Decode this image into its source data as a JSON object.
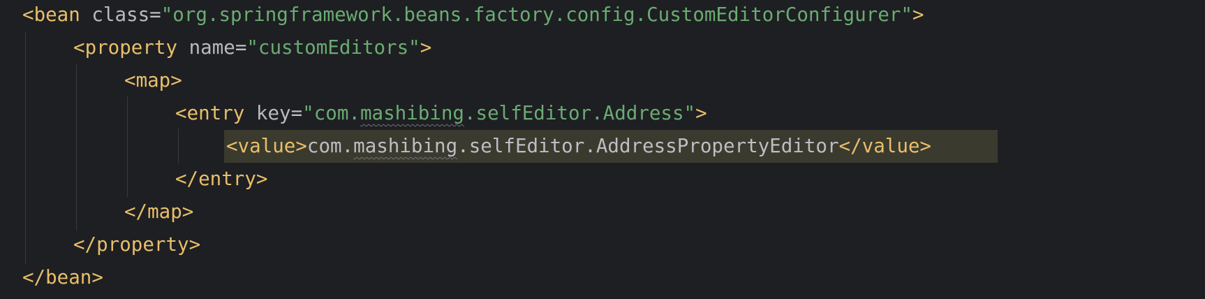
{
  "editor": {
    "lines": {
      "l1": {
        "open": "<",
        "tag": "bean",
        "attr": "class",
        "eq": "=",
        "value": "\"org.springframework.beans.factory.config.CustomEditorConfigurer\"",
        "close": ">"
      },
      "l2": {
        "open": "<",
        "tag": "property",
        "attr": "name",
        "eq": "=",
        "value": "\"customEditors\"",
        "close": ">"
      },
      "l3": {
        "open": "<",
        "tag": "map",
        "close": ">"
      },
      "l4": {
        "open": "<",
        "tag": "entry",
        "attr": "key",
        "eq": "=",
        "value_pre": "\"com.",
        "value_typo": "mashibing",
        "value_post": ".selfEditor.Address\"",
        "close": ">"
      },
      "l5": {
        "open_tag": "<value>",
        "text_pre": "com.",
        "text_typo": "mashibing",
        "text_post": ".selfEditor.AddressPropertyEditor",
        "close_tag": "</value>"
      },
      "l6": {
        "tag": "</entry>"
      },
      "l7": {
        "tag": "</map>"
      },
      "l8": {
        "tag": "</property>"
      },
      "l9": {
        "tag": "</bean>"
      }
    }
  }
}
